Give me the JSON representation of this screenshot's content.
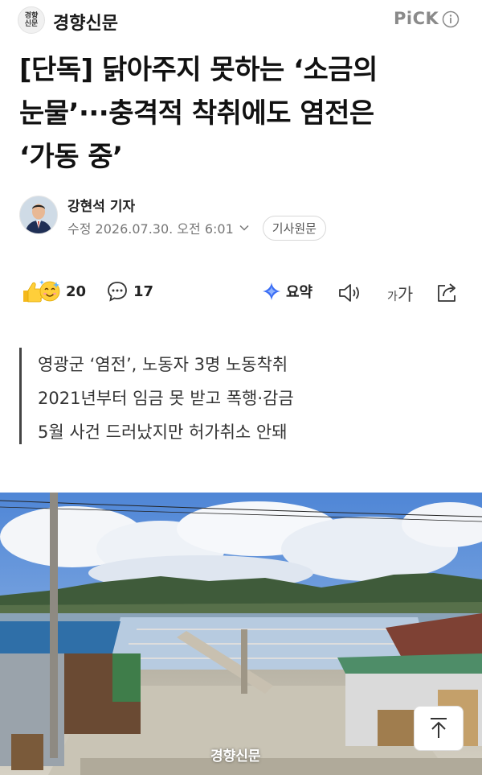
{
  "header": {
    "logo_text": "경향\n신문",
    "press_name": "경향신문",
    "pick_label": "PiCK",
    "info_icon": "info-icon"
  },
  "article": {
    "title_lines": [
      "[단독] 닭아주지 못하는 ‘소금의",
      "눈물’···충격적 착취에도 염전은",
      "‘가동 중’"
    ],
    "reporter": "강현석 기자",
    "modified": "수정 2026.07.30. 오전 6:01",
    "original_button": "기사원문"
  },
  "actions": {
    "like_count": "20",
    "comment_count": "17",
    "summary_label": "요약",
    "fontsize_label": "가가",
    "icons": [
      "reaction-emoji-icon",
      "comment-icon",
      "summary-sparkle-icon",
      "speaker-icon",
      "font-size-icon",
      "share-icon"
    ]
  },
  "summary": [
    "영광군 ‘염전’, 노동자 3명 노동착취",
    "2021년부터 임금 못 받고 폭행·감금",
    "5월 사건 드러났지만 허가취소 안돼"
  ],
  "photo": {
    "watermark": "경향신문"
  },
  "colors": {
    "accent_blue": "#3b6ef5",
    "text_dark": "#111111",
    "text_muted": "#777777"
  }
}
